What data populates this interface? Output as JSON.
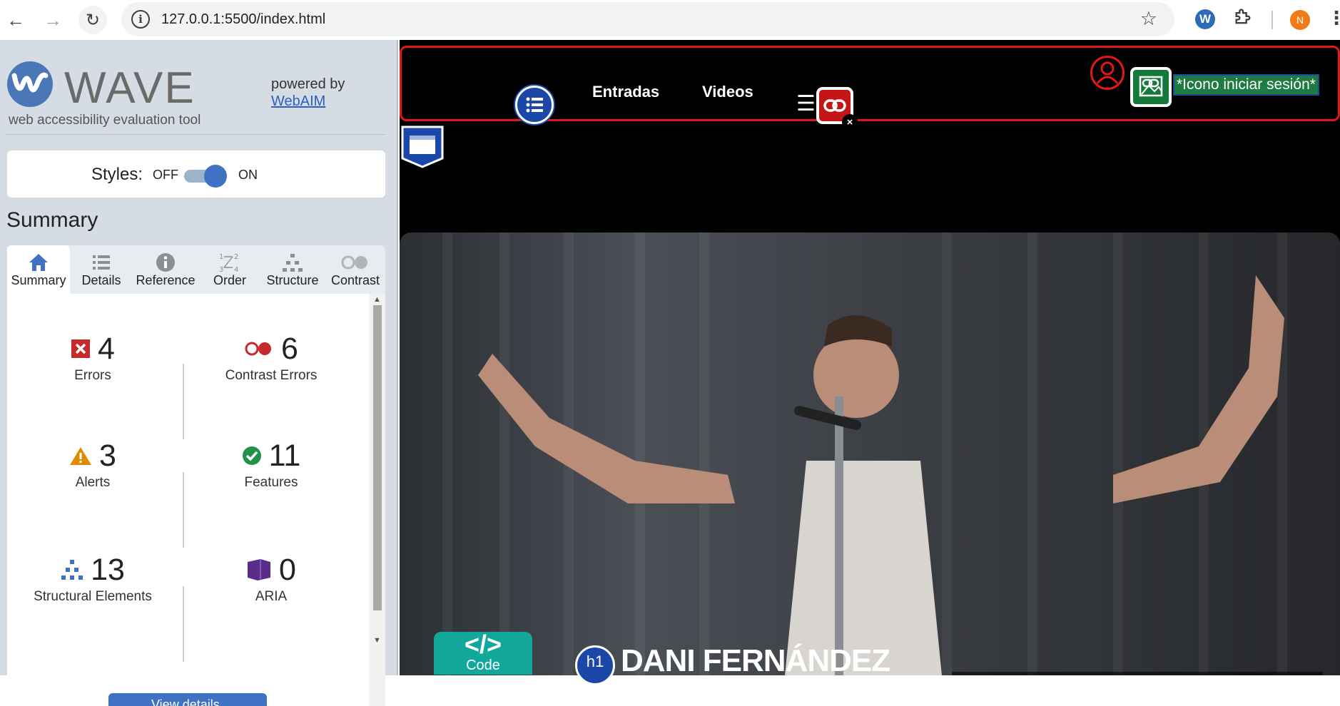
{
  "browser": {
    "url": "127.0.0.1:5500/index.html",
    "profile_initial": "N",
    "extension_initial": "W"
  },
  "wave": {
    "title": "WAVE",
    "subtitle": "web accessibility evaluation tool",
    "powered_by": "powered by",
    "powered_link": "WebAIM",
    "styles_label": "Styles:",
    "styles_off": "OFF",
    "styles_on": "ON",
    "styles_state": "on",
    "heading": "Summary",
    "tabs": [
      {
        "label": "Summary",
        "icon": "home-icon",
        "active": true
      },
      {
        "label": "Details",
        "icon": "list-icon"
      },
      {
        "label": "Reference",
        "icon": "info-icon"
      },
      {
        "label": "Order",
        "icon": "order-icon"
      },
      {
        "label": "Structure",
        "icon": "structure-icon"
      },
      {
        "label": "Contrast",
        "icon": "contrast-icon"
      }
    ],
    "stats": [
      {
        "value": "4",
        "label": "Errors",
        "icon": "error-icon",
        "color": "#c62b2b"
      },
      {
        "value": "6",
        "label": "Contrast Errors",
        "icon": "contrast-error-icon",
        "color": "#c62b2b"
      },
      {
        "value": "3",
        "label": "Alerts",
        "icon": "alert-icon",
        "color": "#e08c00"
      },
      {
        "value": "11",
        "label": "Features",
        "icon": "feature-icon",
        "color": "#22914b"
      },
      {
        "value": "13",
        "label": "Structural Elements",
        "icon": "structure-icon",
        "color": "#3f72c2"
      },
      {
        "value": "0",
        "label": "ARIA",
        "icon": "aria-icon",
        "color": "#5a2d8a"
      }
    ],
    "view_details": "View details"
  },
  "site": {
    "nav": [
      "Entradas",
      "Videos"
    ],
    "login_text": "*Icono iniciar sesión*",
    "code_label": "Code",
    "code_symbol": "</>",
    "h1_badge": "h1",
    "hero_title": "DANI FERNÁNDEZ"
  }
}
